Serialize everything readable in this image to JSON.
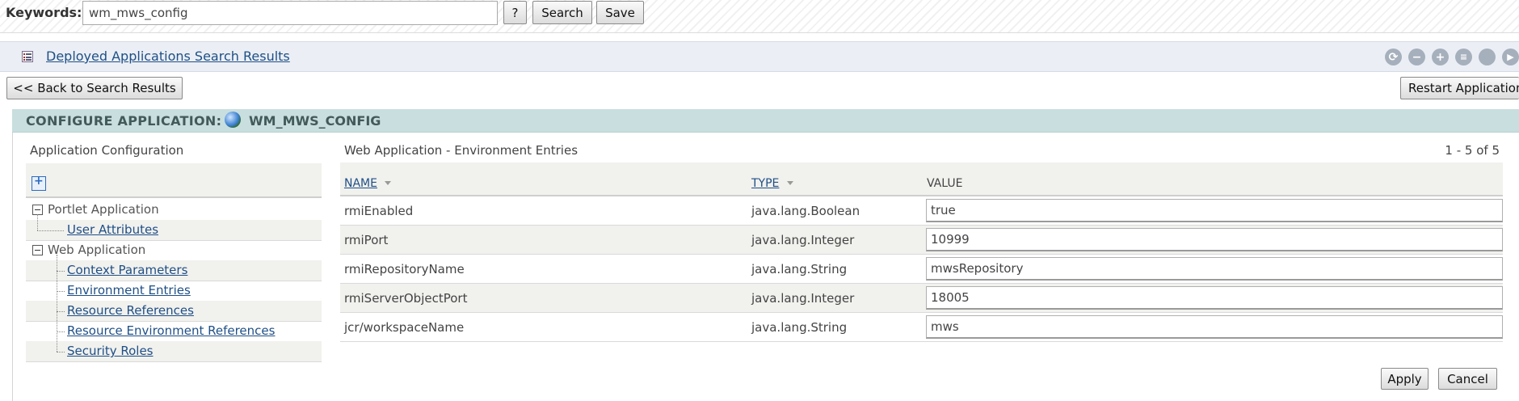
{
  "search": {
    "label": "Keywords:",
    "value": "wm_mws_config",
    "help_label": "?",
    "search_label": "Search",
    "save_label": "Save"
  },
  "portlet": {
    "title": "Deployed Applications Search Results",
    "tool_icons": [
      "refresh-icon",
      "minimize-icon",
      "maximize-icon",
      "properties-icon",
      "help-icon",
      "more-icon"
    ]
  },
  "actions": {
    "back_label": "<< Back to Search Results",
    "restart_label": "Restart Application"
  },
  "configure": {
    "heading": "CONFIGURE APPLICATION:",
    "app_name": "WM_MWS_CONFIG"
  },
  "tree": {
    "title": "Application Configuration",
    "nodes": [
      {
        "label": "Portlet Application"
      },
      {
        "label": "User Attributes"
      },
      {
        "label": "Web Application"
      },
      {
        "label": "Context Parameters"
      },
      {
        "label": "Environment Entries"
      },
      {
        "label": "Resource References"
      },
      {
        "label": "Resource Environment References"
      },
      {
        "label": "Security Roles"
      }
    ]
  },
  "table": {
    "title": "Web Application - Environment Entries",
    "count": "1 - 5 of 5",
    "columns": {
      "name": "NAME",
      "type": "TYPE",
      "value": "VALUE"
    },
    "rows": [
      {
        "name": "rmiEnabled",
        "type": "java.lang.Boolean",
        "value": "true"
      },
      {
        "name": "rmiPort",
        "type": "java.lang.Integer",
        "value": "10999"
      },
      {
        "name": "rmiRepositoryName",
        "type": "java.lang.String",
        "value": "mwsRepository"
      },
      {
        "name": "rmiServerObjectPort",
        "type": "java.lang.Integer",
        "value": "18005"
      },
      {
        "name": "jcr/workspaceName",
        "type": "java.lang.String",
        "value": "mws"
      }
    ]
  },
  "footer": {
    "apply_label": "Apply",
    "cancel_label": "Cancel"
  }
}
